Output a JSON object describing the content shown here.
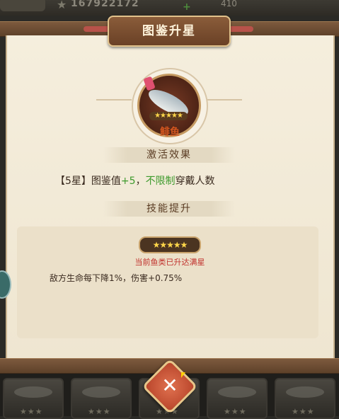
{
  "hud": {
    "score": "167922172",
    "count": "410",
    "plus": "+"
  },
  "dialog": {
    "title": "图鉴升星",
    "fish_name": "鲱鱼",
    "fish_stars": "★★★★★",
    "section_effect": "激活效果",
    "effect_prefix": "【5星】图鉴值",
    "effect_value": "+5",
    "effect_sep": "，",
    "effect_unlimited": "不限制",
    "effect_suffix": "穿戴人数",
    "section_skill": "技能提升",
    "skill_stars": "★★★★★",
    "maxed_text": "当前鱼类已升达满星",
    "skill_desc": "敌方生命每下降1%，伤害+0.75%"
  },
  "close_label": "✕",
  "bottom_cards": [
    {
      "stars": "★★★"
    },
    {
      "stars": "★★★"
    },
    {
      "stars": "★★★"
    },
    {
      "stars": "★★★"
    },
    {
      "stars": "★★★"
    }
  ],
  "colors": {
    "accent_green": "#3d9a2c",
    "accent_red": "#c0302c",
    "name_orange": "#d2551e",
    "gold": "#ffd64a"
  }
}
